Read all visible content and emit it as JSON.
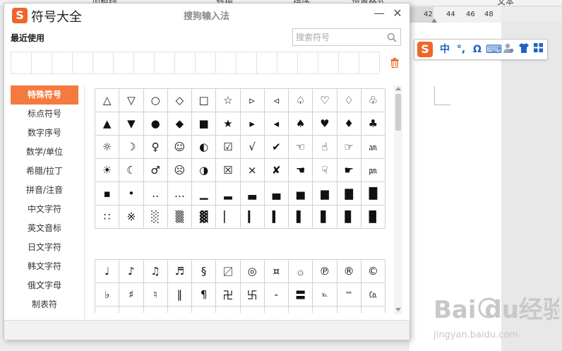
{
  "background": {
    "top_headings": [
      "加粗线",
      "转换",
      "排序",
      "设置格式"
    ],
    "ruler_numbers": [
      "42",
      "44",
      "46",
      "48"
    ],
    "right_heading": "文本"
  },
  "ime_toolbar": {
    "logo": "S",
    "items": [
      {
        "label": "中",
        "icon": "chinese-mode-icon"
      },
      {
        "label": "°,",
        "icon": "punctuation-icon"
      },
      {
        "label": "Ω",
        "icon": "symbol-icon"
      },
      {
        "label": "⌨",
        "icon": "keyboard-icon"
      },
      {
        "label": "",
        "icon": "user-icon"
      },
      {
        "label": "",
        "icon": "skin-shirt-icon"
      },
      {
        "label": "",
        "icon": "grid-menu-icon"
      }
    ]
  },
  "window": {
    "logo": "S",
    "title": "符号大全",
    "subtitle": "搜狗输入法",
    "minimize": "—",
    "close": "✕"
  },
  "recent": {
    "label": "最近使用",
    "cells": 18
  },
  "search": {
    "placeholder": "搜索符号"
  },
  "categories": [
    {
      "label": "特殊符号",
      "active": true
    },
    {
      "label": "标点符号",
      "active": false
    },
    {
      "label": "数字序号",
      "active": false
    },
    {
      "label": "数学/单位",
      "active": false
    },
    {
      "label": "希腊/拉丁",
      "active": false
    },
    {
      "label": "拼音/注音",
      "active": false
    },
    {
      "label": "中文字符",
      "active": false
    },
    {
      "label": "英文音标",
      "active": false
    },
    {
      "label": "日文字符",
      "active": false
    },
    {
      "label": "韩文字符",
      "active": false
    },
    {
      "label": "俄文字母",
      "active": false
    },
    {
      "label": "制表符",
      "active": false
    }
  ],
  "symbol_grid_1": [
    [
      "△",
      "▽",
      "○",
      "◇",
      "□",
      "☆",
      "▹",
      "◃",
      "♤",
      "♡",
      "♢",
      "♧"
    ],
    [
      "▲",
      "▼",
      "●",
      "◆",
      "■",
      "★",
      "▸",
      "◂",
      "♠",
      "♥",
      "♦",
      "♣"
    ],
    [
      "☼",
      "☽",
      "♀",
      "☺",
      "◐",
      "☑",
      "√",
      "✔",
      "☜",
      "☝",
      "☞",
      "㏂"
    ],
    [
      "☀",
      "☾",
      "♂",
      "☹",
      "◑",
      "☒",
      "×",
      "✘",
      "☚",
      "☟",
      "☛",
      "㏘"
    ],
    [
      "▪",
      "•",
      "‥",
      "…",
      "▁",
      "▂",
      "▃",
      "▄",
      "▅",
      "▆",
      "▇",
      "█"
    ],
    [
      "∷",
      "※",
      "░",
      "▒",
      "▓",
      "▏",
      "▎",
      "▍",
      "▌",
      "▋",
      "▊",
      "▉"
    ]
  ],
  "symbol_grid_2": [
    [
      "♩",
      "♪",
      "♫",
      "♬",
      "§",
      "〼",
      "◎",
      "¤",
      "۞",
      "℗",
      "®",
      "©"
    ],
    [
      "♭",
      "♯",
      "♮",
      "‖",
      "¶",
      "卍",
      "卐",
      "‐",
      "〓",
      "℡",
      "™",
      "㏇"
    ],
    [
      "",
      "",
      "",
      "",
      "",
      "",
      "",
      "",
      "",
      "",
      "",
      ""
    ]
  ],
  "watermark": {
    "brand": "Bai du经验",
    "url": "jingyan.baidu.com"
  }
}
